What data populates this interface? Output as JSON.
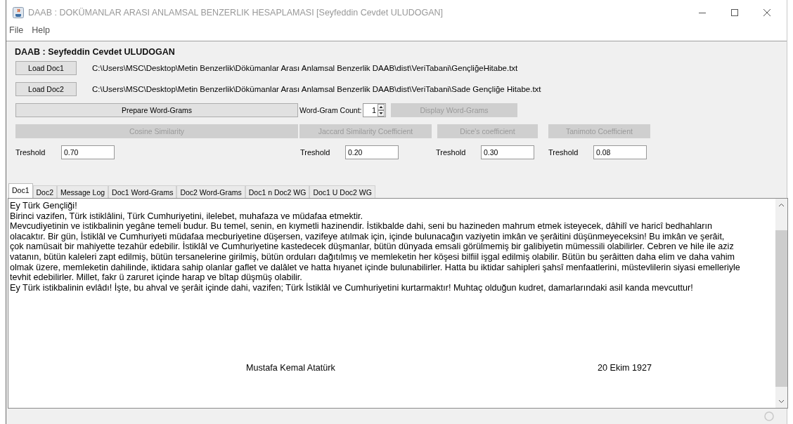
{
  "window": {
    "title": "DAAB : DOKÜMANLAR ARASI ANLAMSAL BENZERLIK HESAPLAMASI [Seyfeddin Cevdet ULUDOGAN]"
  },
  "menu": [
    {
      "label": "File"
    },
    {
      "label": "Help"
    }
  ],
  "heading": "DAAB : Seyfeddin Cevdet ULUDOGAN",
  "documents": [
    {
      "button": "Load Doc1",
      "path": "C:\\Users\\MSC\\Desktop\\Metin Benzerlik\\Dökümanlar Arası Anlamsal Benzerlik DAAB\\dist\\VeriTabani\\GençliğeHitabe.txt"
    },
    {
      "button": "Load Doc2",
      "path": "C:\\Users\\MSC\\Desktop\\Metin Benzerlik\\Dökümanlar Arası Anlamsal Benzerlik DAAB\\dist\\VeriTabani\\Sade Gençliğe Hitabe.txt"
    }
  ],
  "word_grams": {
    "prepare_button": {
      "label": "Prepare Word-Grams",
      "disabled": false
    },
    "count_label": "Word-Gram Count:",
    "count": "1",
    "display_button": {
      "label": "Display Word-Grams",
      "disabled": true
    }
  },
  "similarities": [
    {
      "button": "Cosine Similarity",
      "disabled": true,
      "threshold_label": "Treshold",
      "threshold": "0.70"
    },
    {
      "button": "Jaccard Similarity Coefficient",
      "disabled": true,
      "threshold_label": "Treshold",
      "threshold": "0.20"
    },
    {
      "button": "Dice's coefficient",
      "disabled": true,
      "threshold_label": "Treshold",
      "threshold": "0.30"
    },
    {
      "button": "Tanimoto Coefficient",
      "disabled": true,
      "threshold_label": "Treshold",
      "threshold": "0.08"
    }
  ],
  "tabs": [
    {
      "label": "Doc1",
      "selected": true
    },
    {
      "label": "Doc2",
      "selected": false
    },
    {
      "label": "Message Log",
      "selected": false
    },
    {
      "label": "Doc1 Word-Grams",
      "selected": false
    },
    {
      "label": "Doc2 Word-Grams",
      "selected": false
    },
    {
      "label": "Doc1 n Doc2 WG",
      "selected": false
    },
    {
      "label": "Doc1 U Doc2 WG",
      "selected": false
    }
  ],
  "document_text": {
    "lines": [
      "Ey Türk Gençliği!",
      "Birinci vazifen, Türk istiklâlini, Türk Cumhuriyetini, ilelebet, muhafaza ve müdafaa etmektir.",
      "Mevcudiyetinin ve istikbalinin yegâne temeli budur. Bu temel, senin, en kıymetli hazinendir. İstikbalde dahi, seni bu hazineden mahrum etmek isteyecek, dâhilî ve haricî bedhahların",
      "olacaktır. Bir gün, İstiklâl ve Cumhuriyeti müdafaa mecburiyetine düşersen, vazifeye atılmak için, içinde bulunacağın vaziyetin imkân ve şerâitini düşünmeyeceksin! Bu imkân ve şerâit,",
      "çok namüsait bir mahiyette tezahür edebilir. İstiklâl ve Cumhuriyetine kastedecek düşmanlar, bütün dünyada emsali görülmemiş bir galibiyetin mümessili olabilirler. Cebren ve hile ile aziz",
      "vatanın, bütün kaleleri zapt edilmiş, bütün tersanelerine girilmiş, bütün orduları dağıtılmış ve memleketin her köşesi bilfiil işgal edilmiş olabilir. Bütün bu şerâitten daha elim ve daha vahim",
      "olmak üzere, memleketin dahilinde, iktidara sahip olanlar gaflet ve dalâlet ve hatta hıyanet içinde bulunabilirler. Hatta bu iktidar sahipleri şahsî menfaatlerini, müstevlilerin siyasi emelleriyle",
      "tevhit edebilirler. Millet, fakr ü zaruret içinde harap ve bîtap düşmüş olabilir.",
      "Ey Türk istikbalinin evlâdı! İşte, bu ahval ve şerâit içinde dahi, vazifen; Türk İstiklâl ve Cumhuriyetini kurtarmaktır! Muhtaç olduğun kudret, damarlarındaki asil kanda mevcuttur!"
    ],
    "author": "Mustafa Kemal Atatürk",
    "date": "20 Ekim 1927"
  }
}
